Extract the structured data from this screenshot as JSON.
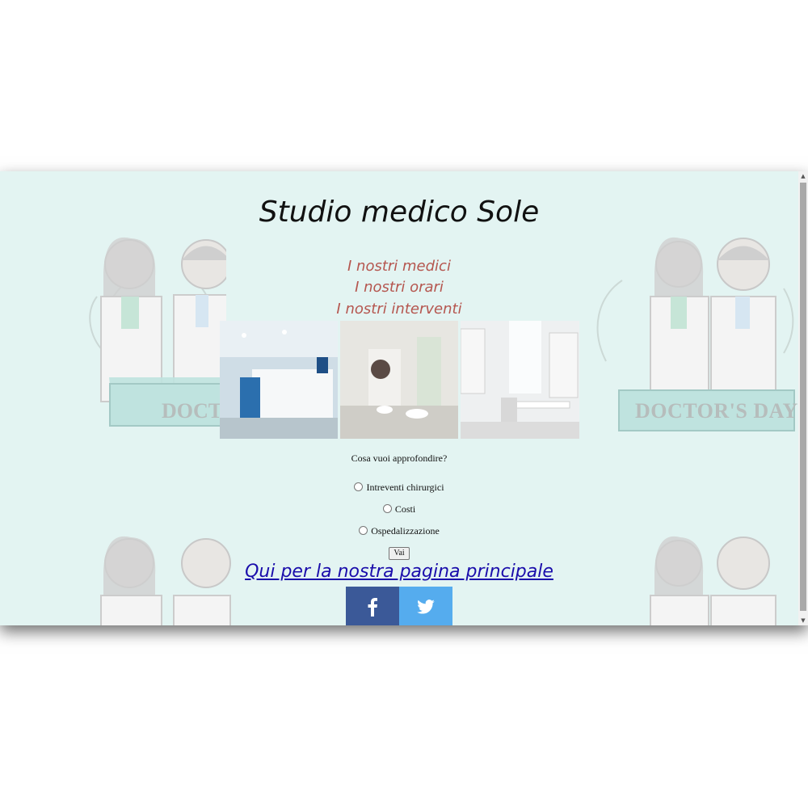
{
  "title": "Studio medico Sole",
  "nav": [
    "I nostri medici",
    "I nostri orari",
    "I nostri interventi"
  ],
  "background_banner_text": "DOCTOR'S DAY",
  "form": {
    "question": "Cosa vuoi approfondire?",
    "options": [
      "Intreventi chirurgici",
      "Costi",
      "Ospedalizzazione"
    ],
    "submit_label": "Vai"
  },
  "main_page_link": "Qui per la nostra pagina principale",
  "social": [
    {
      "icon": "facebook-icon",
      "color": "#3b5998"
    },
    {
      "icon": "twitter-icon",
      "color": "#55acee"
    }
  ],
  "colors": {
    "page_background": "#e3f4f2",
    "nav_link": "#b5564f",
    "link": "#1a0dab"
  }
}
